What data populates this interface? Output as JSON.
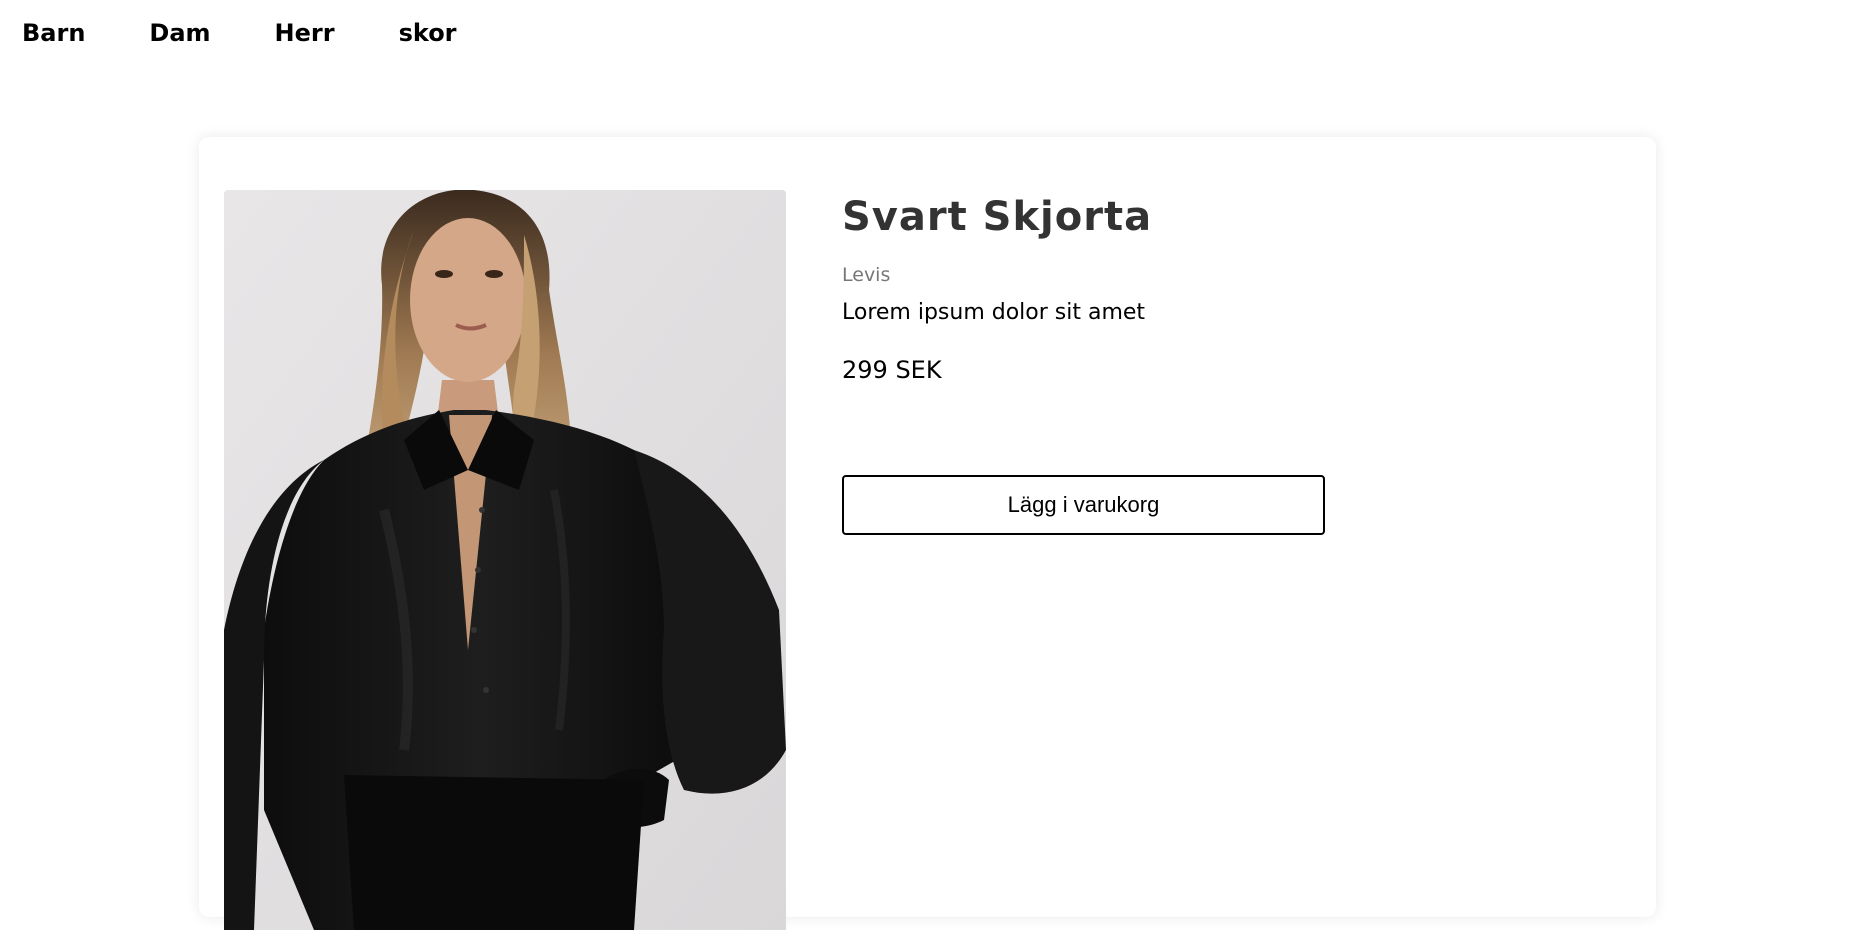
{
  "nav": {
    "items": [
      {
        "label": "Barn"
      },
      {
        "label": "Dam"
      },
      {
        "label": "Herr"
      },
      {
        "label": "skor"
      }
    ]
  },
  "product": {
    "title": "Svart Skjorta",
    "brand": "Levis",
    "description": "Lorem ipsum dolor sit amet",
    "price": "299 SEK",
    "add_to_cart_label": "Lägg i varukorg",
    "image_alt": "Model wearing a black satin shirt"
  },
  "colors": {
    "background": "#ffffff",
    "title": "#333333",
    "brand": "#777777",
    "button_border": "#000000"
  }
}
